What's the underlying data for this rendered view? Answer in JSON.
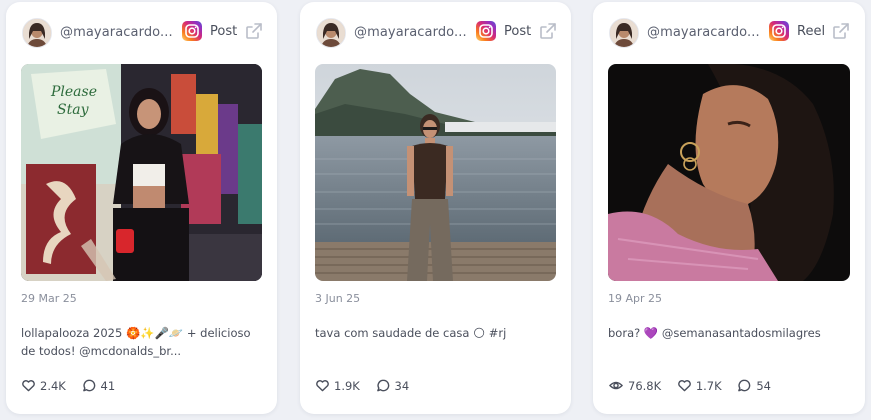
{
  "posts": [
    {
      "handle": "@mayaracardo...",
      "type": "Post",
      "date": "29 Mar 25",
      "caption": "lollapalooza 2025 🏵️✨🎤🪐 + delicioso de todos! @mcdonalds_br...",
      "likes": "2.4K",
      "comments": "41"
    },
    {
      "handle": "@mayaracardo...",
      "type": "Post",
      "date": "3 Jun 25",
      "caption": "tava com saudade de casa 🌕 #rj",
      "likes": "1.9K",
      "comments": "34"
    },
    {
      "handle": "@mayaracardo...",
      "type": "Reel",
      "date": "19 Apr 25",
      "caption": "bora? 💜 @semanasantadosmilagres",
      "views": "76.8K",
      "likes": "1.7K",
      "comments": "54"
    }
  ],
  "icons": {
    "platform": "instagram-icon",
    "external": "external-link-icon",
    "likes": "heart-icon",
    "comments": "comment-icon",
    "views": "eye-icon"
  },
  "colors": {
    "background": "#eef0f5",
    "card": "#ffffff",
    "muted_text": "#8a8f9c",
    "text": "#4a4f5c"
  }
}
